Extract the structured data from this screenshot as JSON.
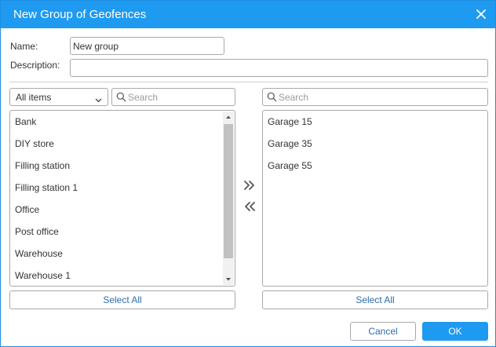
{
  "dialog": {
    "title": "New Group of Geofences"
  },
  "form": {
    "name_label": "Name:",
    "name_value": "New group",
    "description_label": "Description:",
    "description_value": ""
  },
  "left_panel": {
    "filter_selected": "All items",
    "search_placeholder": "Search",
    "items": [
      "Bank",
      "DIY store",
      "Filling station",
      "Filling station 1",
      "Office",
      "Post office",
      "Warehouse",
      "Warehouse 1"
    ],
    "select_all_label": "Select All"
  },
  "right_panel": {
    "search_placeholder": "Search",
    "items": [
      "Garage 15",
      "Garage 35",
      "Garage 55"
    ],
    "select_all_label": "Select All"
  },
  "transfer": {
    "add_icon": "double-chevron-right-icon",
    "remove_icon": "double-chevron-left-icon"
  },
  "footer": {
    "cancel_label": "Cancel",
    "ok_label": "OK"
  },
  "colors": {
    "accent": "#1e9af0",
    "link_text": "#2b6cb0"
  }
}
